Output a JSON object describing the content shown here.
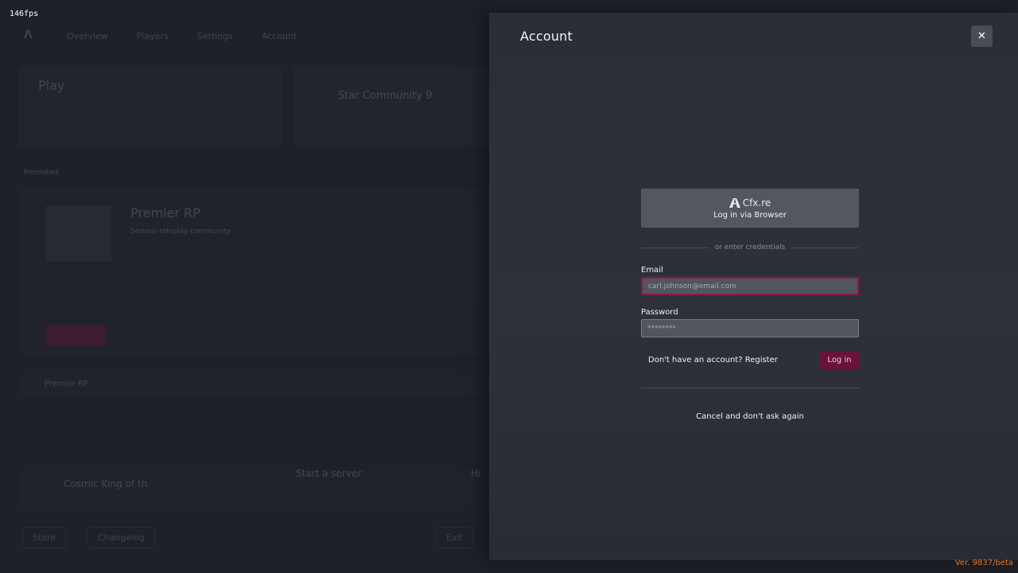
{
  "overlay": {
    "fps": "146fps",
    "version": "Ver. 9837/beta"
  },
  "background": {
    "nav": [
      "Overview",
      "Players",
      "Settings",
      "Account"
    ],
    "play_label": "Play",
    "featured_server": "Star Community 9",
    "promoted_label": "Promoted",
    "server_name": "Premier RP",
    "server_sub": "Serious roleplay community",
    "list_title": "Premier RP",
    "cards": [
      "Cosmic King of th",
      "Start a server",
      "Hi"
    ],
    "footer": [
      "Store",
      "Changelog",
      "Exit"
    ]
  },
  "account": {
    "title": "Account",
    "close_icon": "close-icon",
    "browser_login": {
      "brand": "Cfx.re",
      "label": "Log in via Browser"
    },
    "divider_text": "or enter credentials",
    "email": {
      "label": "Email",
      "placeholder": "carl.johnson@email.com",
      "value": ""
    },
    "password": {
      "label": "Password",
      "placeholder": "********",
      "value": ""
    },
    "register_text": "Don't have an account? Register",
    "login_button": "Log in",
    "cancel_text": "Cancel and don't ask again",
    "colors": {
      "accent": "#6b1238",
      "focus_border": "#8a1a4c",
      "version_text": "#e07a2e"
    }
  }
}
